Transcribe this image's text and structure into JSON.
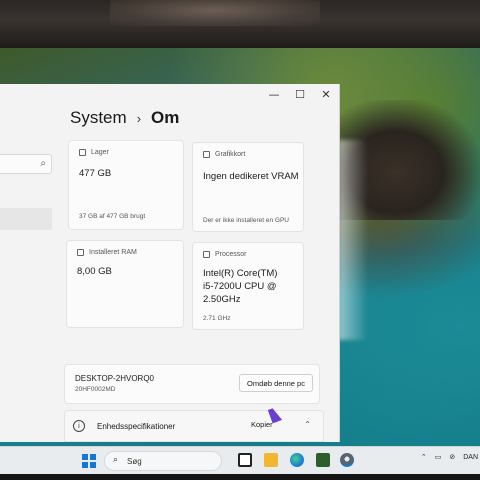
{
  "window": {
    "controls": {
      "minimize": "—",
      "maximize": "☐",
      "close": "✕"
    },
    "breadcrumb": {
      "parent": "System",
      "separator": "›",
      "current": "Om"
    }
  },
  "search": {
    "icon": "search-icon"
  },
  "cards": {
    "storage": {
      "label": "Lager",
      "value": "477 GB",
      "sub": "37 GB af 477 GB brugt"
    },
    "graphics": {
      "label": "Grafikkort",
      "value": "Ingen dedikeret VRAM",
      "sub": "Der er ikke installeret en GPU"
    },
    "ram": {
      "label": "Installeret RAM",
      "value": "8,00 GB"
    },
    "processor": {
      "label": "Processor",
      "value_line1": "Intel(R) Core(TM)",
      "value_line2": "i5-7200U CPU @",
      "value_line3": "2.50GHz",
      "sub": "2.71 GHz"
    }
  },
  "device": {
    "name": "DESKTOP-2HVORQ0",
    "model": "20HF0002MD",
    "rename_label": "Omdøb denne pc"
  },
  "specs": {
    "label": "Enhedsspecifikationer",
    "copy_label": "Kopier"
  },
  "taskbar": {
    "search_label": "Søg",
    "language": "DAN"
  }
}
